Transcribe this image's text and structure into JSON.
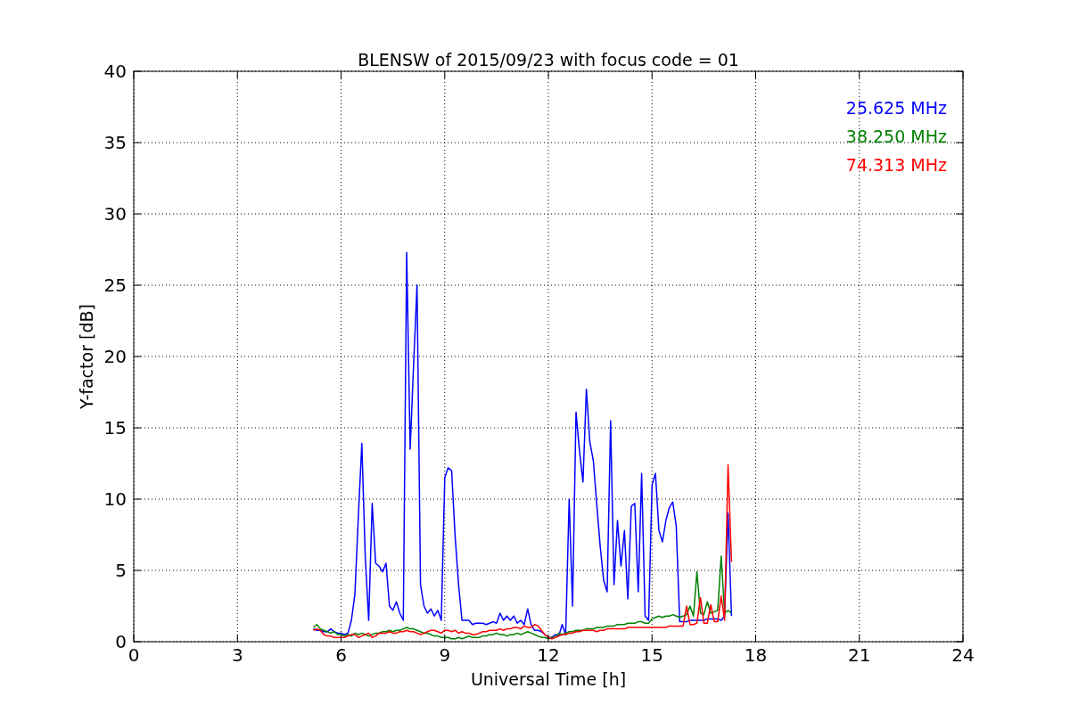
{
  "chart_data": {
    "type": "line",
    "title": "BLENSW of 2015/09/23 with focus code = 01",
    "xlabel": "Universal Time [h]",
    "ylabel": "Y-factor [dB]",
    "grid": true,
    "xlim": [
      0,
      24
    ],
    "ylim": [
      0,
      40
    ],
    "xticks": [
      0,
      3,
      6,
      9,
      12,
      15,
      18,
      21,
      24
    ],
    "yticks": [
      0,
      5,
      10,
      15,
      20,
      25,
      30,
      35,
      40
    ],
    "x": [
      5.2,
      5.3,
      5.4,
      5.5,
      5.6,
      5.7,
      5.8,
      5.9,
      6.0,
      6.1,
      6.2,
      6.3,
      6.4,
      6.5,
      6.6,
      6.7,
      6.8,
      6.9,
      7.0,
      7.1,
      7.2,
      7.3,
      7.4,
      7.5,
      7.6,
      7.7,
      7.8,
      7.9,
      8.0,
      8.1,
      8.2,
      8.3,
      8.4,
      8.5,
      8.6,
      8.7,
      8.8,
      8.9,
      9.0,
      9.1,
      9.2,
      9.3,
      9.4,
      9.5,
      9.6,
      9.7,
      9.8,
      9.9,
      10.0,
      10.1,
      10.2,
      10.3,
      10.4,
      10.5,
      10.6,
      10.7,
      10.8,
      10.9,
      11.0,
      11.1,
      11.2,
      11.3,
      11.4,
      11.5,
      11.6,
      11.7,
      11.8,
      11.9,
      12.0,
      12.1,
      12.2,
      12.3,
      12.4,
      12.5,
      12.6,
      12.7,
      12.8,
      12.9,
      13.0,
      13.1,
      13.2,
      13.3,
      13.4,
      13.5,
      13.6,
      13.7,
      13.8,
      13.9,
      14.0,
      14.1,
      14.2,
      14.3,
      14.4,
      14.5,
      14.6,
      14.7,
      14.8,
      14.9,
      15.0,
      15.1,
      15.2,
      15.3,
      15.4,
      15.5,
      15.6,
      15.7,
      15.8,
      15.9,
      16.0,
      16.1,
      16.2,
      16.3,
      16.4,
      16.5,
      16.6,
      16.7,
      16.8,
      16.9,
      17.0,
      17.1,
      17.2,
      17.3
    ],
    "series": [
      {
        "name": "25.625 MHz",
        "color": "#0000ff",
        "values": [
          0.9,
          0.8,
          0.8,
          0.7,
          0.7,
          0.9,
          0.7,
          0.6,
          0.6,
          0.5,
          0.6,
          1.5,
          3.3,
          8.8,
          13.9,
          6.0,
          1.5,
          9.7,
          5.5,
          5.3,
          4.9,
          5.5,
          2.5,
          2.2,
          2.8,
          2.0,
          1.5,
          27.3,
          13.5,
          19.5,
          25.0,
          4.0,
          2.5,
          2.0,
          2.3,
          1.8,
          2.2,
          1.5,
          11.5,
          12.2,
          12.0,
          7.4,
          4.0,
          1.5,
          1.5,
          1.5,
          1.2,
          1.3,
          1.3,
          1.3,
          1.2,
          1.3,
          1.4,
          1.3,
          2.0,
          1.5,
          1.8,
          1.5,
          1.8,
          1.3,
          1.5,
          1.2,
          2.3,
          1.2,
          0.8,
          0.8,
          0.7,
          0.5,
          0.3,
          0.3,
          0.5,
          0.4,
          1.2,
          0.5,
          10.0,
          2.5,
          16.1,
          13.4,
          11.2,
          17.7,
          14.0,
          12.7,
          9.6,
          6.7,
          4.3,
          3.5,
          15.5,
          4.0,
          8.5,
          5.3,
          7.8,
          3.0,
          9.5,
          9.7,
          3.5,
          11.8,
          1.8,
          1.5,
          11.0,
          11.8,
          7.8,
          7.0,
          8.5,
          9.4,
          9.8,
          8.1,
          1.4,
          1.4,
          1.4,
          1.5,
          1.5,
          1.5,
          1.5,
          1.5,
          1.6,
          1.6,
          1.6,
          1.6,
          1.5,
          1.8,
          9.0,
          1.8
        ]
      },
      {
        "name": "38.250 MHz",
        "color": "#008000",
        "values": [
          1.0,
          1.2,
          0.9,
          0.8,
          0.7,
          0.6,
          0.7,
          0.5,
          0.5,
          0.4,
          0.5,
          0.4,
          0.6,
          0.5,
          0.6,
          0.5,
          0.4,
          0.5,
          0.6,
          0.6,
          0.7,
          0.7,
          0.8,
          0.7,
          0.8,
          0.8,
          0.9,
          1.0,
          0.9,
          0.9,
          0.8,
          0.7,
          0.6,
          0.6,
          0.5,
          0.4,
          0.4,
          0.3,
          0.3,
          0.3,
          0.2,
          0.2,
          0.3,
          0.2,
          0.3,
          0.4,
          0.3,
          0.3,
          0.3,
          0.4,
          0.4,
          0.5,
          0.5,
          0.6,
          0.5,
          0.5,
          0.4,
          0.5,
          0.5,
          0.6,
          0.5,
          0.6,
          0.7,
          0.6,
          0.5,
          0.4,
          0.3,
          0.3,
          0.2,
          0.3,
          0.3,
          0.6,
          0.5,
          0.6,
          0.7,
          0.7,
          0.8,
          0.8,
          0.8,
          0.9,
          0.9,
          0.9,
          1.0,
          1.0,
          1.0,
          1.1,
          1.1,
          1.1,
          1.2,
          1.2,
          1.2,
          1.3,
          1.3,
          1.3,
          1.4,
          1.4,
          1.3,
          1.3,
          1.6,
          1.7,
          1.8,
          1.7,
          1.8,
          1.8,
          1.9,
          1.8,
          1.7,
          1.8,
          1.9,
          2.5,
          1.8,
          4.9,
          2.0,
          1.9,
          2.8,
          2.0,
          2.1,
          2.2,
          6.0,
          2.0,
          2.2,
          2.0
        ]
      },
      {
        "name": "74.313 MHz",
        "color": "#ff0000",
        "values": [
          0.8,
          0.9,
          0.8,
          0.5,
          0.4,
          0.4,
          0.3,
          0.3,
          0.3,
          0.3,
          0.4,
          0.5,
          0.5,
          0.3,
          0.4,
          0.5,
          0.6,
          0.3,
          0.4,
          0.6,
          0.6,
          0.6,
          0.7,
          0.6,
          0.6,
          0.7,
          0.7,
          0.8,
          0.7,
          0.7,
          0.6,
          0.5,
          0.6,
          0.7,
          0.8,
          0.8,
          0.7,
          0.6,
          0.8,
          0.8,
          0.7,
          0.8,
          0.6,
          0.7,
          0.6,
          0.6,
          0.5,
          0.5,
          0.6,
          0.7,
          0.7,
          0.8,
          0.8,
          0.8,
          0.9,
          0.8,
          0.9,
          0.9,
          1.0,
          1.0,
          0.9,
          1.1,
          1.0,
          1.0,
          1.2,
          1.1,
          0.8,
          0.5,
          0.3,
          0.2,
          0.3,
          0.4,
          0.5,
          0.5,
          0.6,
          0.6,
          0.7,
          0.7,
          0.8,
          0.8,
          0.8,
          0.8,
          0.7,
          0.8,
          0.8,
          0.9,
          0.9,
          0.9,
          0.9,
          0.9,
          0.9,
          1.0,
          1.0,
          1.0,
          1.0,
          1.0,
          1.0,
          1.0,
          1.0,
          1.0,
          1.0,
          1.0,
          1.0,
          1.1,
          1.1,
          1.1,
          1.1,
          1.1,
          2.5,
          1.2,
          1.2,
          1.3,
          3.1,
          1.3,
          1.3,
          2.6,
          1.4,
          1.4,
          3.2,
          1.5,
          12.4,
          5.6
        ]
      }
    ]
  }
}
